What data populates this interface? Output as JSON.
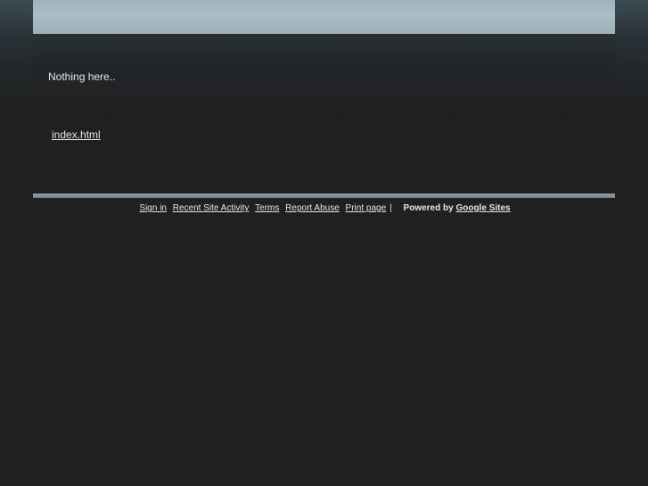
{
  "content": {
    "message": "Nothing here..",
    "file_link": "index.html"
  },
  "footer": {
    "sign_in": "Sign in",
    "recent_activity": "Recent Site Activity",
    "terms": "Terms",
    "report_abuse": "Report Abuse",
    "print_page": "Print page",
    "separator": "|",
    "powered_by": "Powered by",
    "google_sites": "Google Sites"
  },
  "colors": {
    "background": "#202020",
    "header_band": "#aabdc4",
    "footer_rule": "#8ea0a8",
    "text": "#e6e6e6"
  }
}
